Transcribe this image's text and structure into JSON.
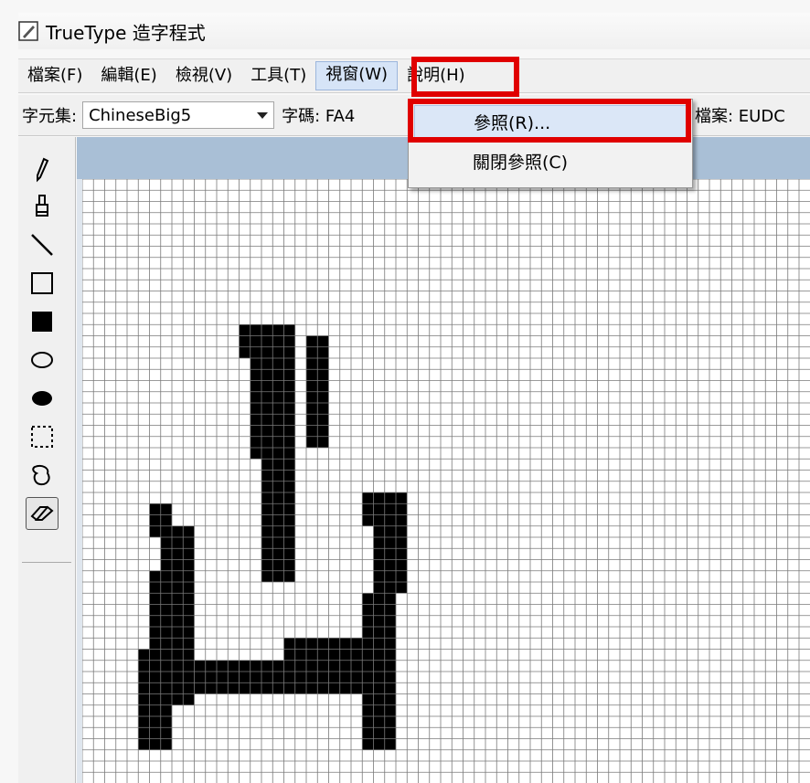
{
  "window": {
    "title": "TrueType 造字程式",
    "icon": "edit-pen-icon"
  },
  "menu": {
    "items": [
      "檔案(F)",
      "編輯(E)",
      "檢視(V)",
      "工具(T)",
      "視窗(W)",
      "說明(H)"
    ],
    "active": "視窗(W)"
  },
  "toolbar": {
    "charset_label": "字元集:",
    "charset_value": "ChineseBig5",
    "code_label": "字碼: FA4",
    "file_label": "檔案: EUDC"
  },
  "window_menu_popup": {
    "items": [
      "參照(R)...",
      "關閉參照(C)"
    ],
    "highlighted": "參照(R)..."
  },
  "tools": [
    "pencil-icon",
    "brush-icon",
    "line-icon",
    "rectangle-outline-icon",
    "rectangle-filled-icon",
    "ellipse-outline-icon",
    "ellipse-filled-icon",
    "rect-select-icon",
    "freeform-select-icon",
    "eraser-icon"
  ],
  "selected_tool": "eraser-icon",
  "colors": {
    "highlight_red": "#e00000",
    "canvas_header": "#a9bfd6",
    "menu_hover": "#dbe7f7"
  }
}
